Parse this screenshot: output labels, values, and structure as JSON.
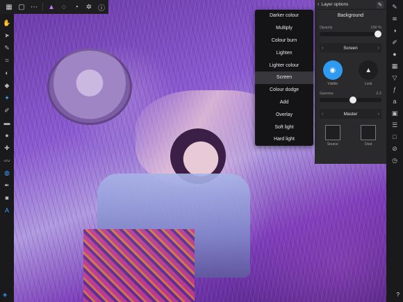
{
  "toolbar": {
    "items": [
      {
        "name": "gallery-icon",
        "glyph": "▦"
      },
      {
        "name": "save-icon",
        "glyph": "▢"
      },
      {
        "name": "more-icon",
        "glyph": "⋯"
      },
      {
        "name": "persona-icon",
        "glyph": "▲"
      },
      {
        "name": "comment-icon",
        "glyph": "◌"
      },
      {
        "name": "history-icon",
        "glyph": "◔"
      },
      {
        "name": "settings-icon",
        "glyph": "✲"
      },
      {
        "name": "info-icon",
        "glyph": "ⓘ"
      }
    ]
  },
  "blend_menu": {
    "items": [
      "Darker colour",
      "Multiply",
      "Colour burn",
      "Lighten",
      "Lighter colour",
      "Screen",
      "Colour dodge",
      "Add",
      "Overlay",
      "Soft light",
      "Hard light"
    ],
    "selected": "Screen"
  },
  "layer_options": {
    "title": "Layer options",
    "layer_name": "Background",
    "opacity_label": "Opacity",
    "opacity_value": "100 %",
    "opacity_fraction": 1.0,
    "blend_mode": "Screen",
    "visible_label": "Visible",
    "lock_label": "Lock",
    "gamma_label": "Gamma",
    "gamma_value": "2.2",
    "gamma_fraction": 0.55,
    "channel": "Master",
    "source_label": "Source",
    "dest_label": "Dest"
  },
  "help_label": "?",
  "colors": {
    "accent": "#2f9bf0",
    "panel": "#2a2a2d",
    "menu": "#141416"
  }
}
